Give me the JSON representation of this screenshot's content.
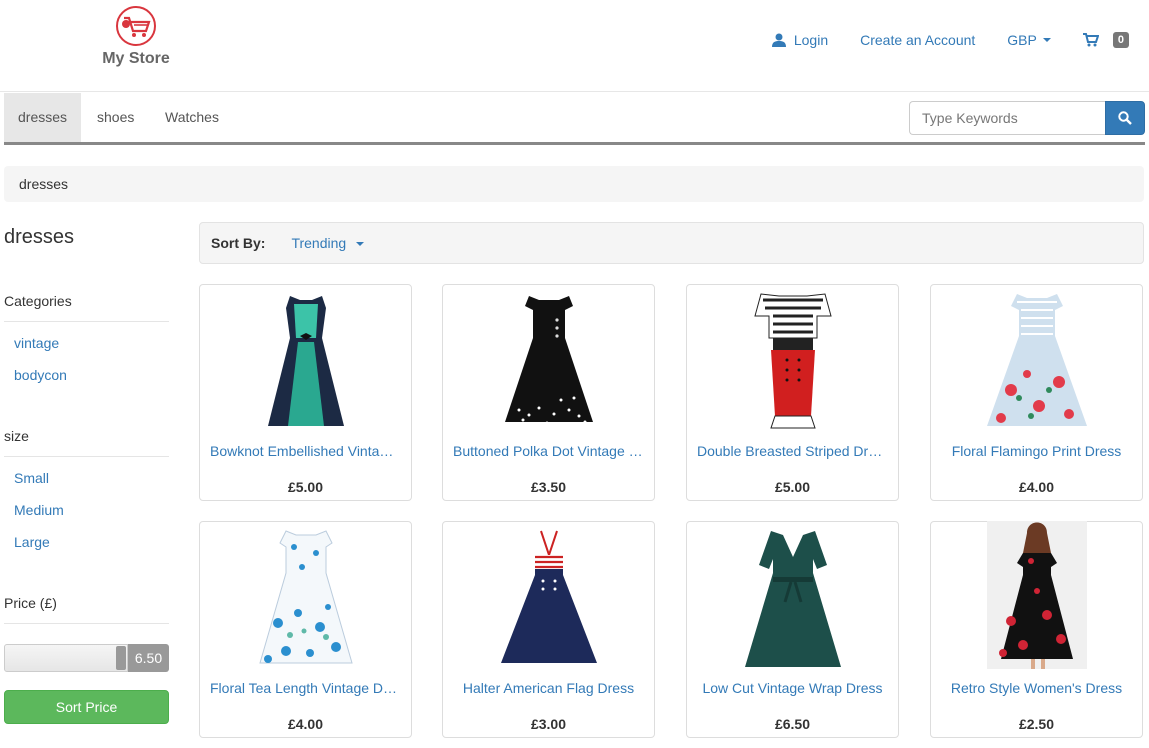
{
  "brand": {
    "name": "My Store"
  },
  "top_links": {
    "login": "Login",
    "create_account": "Create an Account",
    "currency": "GBP",
    "cart_count": "0"
  },
  "nav": {
    "items": [
      {
        "label": "dresses",
        "active": true
      },
      {
        "label": "shoes",
        "active": false
      },
      {
        "label": "Watches",
        "active": false
      }
    ],
    "search_placeholder": "Type Keywords"
  },
  "breadcrumb": "dresses",
  "sidebar": {
    "title": "dresses",
    "categories_heading": "Categories",
    "categories": [
      "vintage",
      "bodycon"
    ],
    "size_heading": "size",
    "sizes": [
      "Small",
      "Medium",
      "Large"
    ],
    "price_heading": "Price (£)",
    "price_value": "6.50",
    "sort_price_label": "Sort Price"
  },
  "sort": {
    "label": "Sort By:",
    "value": "Trending"
  },
  "products": [
    {
      "name": "Bowknot Embellished Vintage Dress",
      "price": "£5.00"
    },
    {
      "name": "Buttoned Polka Dot Vintage Dress",
      "price": "£3.50"
    },
    {
      "name": "Double Breasted Striped Dress",
      "price": "£5.00"
    },
    {
      "name": "Floral Flamingo Print Dress",
      "price": "£4.00"
    },
    {
      "name": "Floral Tea Length Vintage Dress",
      "price": "£4.00"
    },
    {
      "name": "Halter American Flag Dress",
      "price": "£3.00"
    },
    {
      "name": "Low Cut Vintage Wrap Dress",
      "price": "£6.50"
    },
    {
      "name": "Retro Style Women's Dress",
      "price": "£2.50"
    }
  ],
  "colors": {
    "link": "#337ab7",
    "success": "#5cb85c",
    "logo": "#d9363e"
  }
}
